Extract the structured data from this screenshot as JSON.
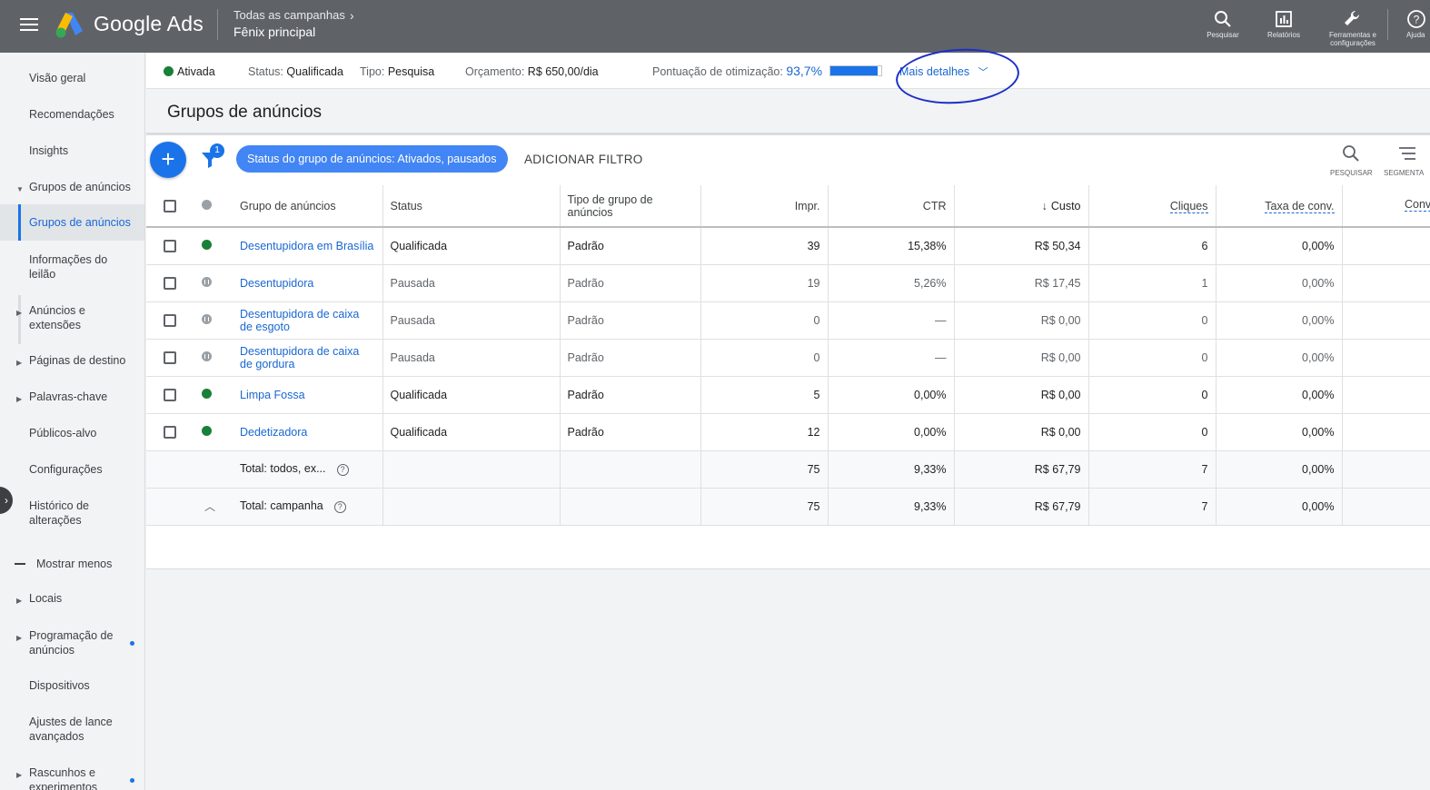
{
  "app": {
    "brand": "Google Ads"
  },
  "breadcrumb": {
    "parent": "Todas as campanhas",
    "current": "Fênix principal"
  },
  "top_tools": [
    {
      "label": "Pesquisar",
      "icon": "search-icon"
    },
    {
      "label": "Relatórios",
      "icon": "reports-icon"
    },
    {
      "label": "Ferramentas e configurações",
      "icon": "wrench-icon"
    },
    {
      "label": "Ajuda",
      "icon": "help-icon"
    }
  ],
  "sidebar": {
    "items": [
      {
        "label": "Visão geral"
      },
      {
        "label": "Recomendações"
      },
      {
        "label": "Insights"
      },
      {
        "label": "Grupos de anúncios",
        "caret": "down"
      },
      {
        "label": "Grupos de anúncios",
        "active": true
      },
      {
        "label": "Informações do leilão"
      },
      {
        "label": "Anúncios e extensões",
        "caret": "right"
      },
      {
        "label": "Páginas de destino",
        "caret": "right"
      },
      {
        "label": "Palavras-chave",
        "caret": "right"
      },
      {
        "label": "Públicos-alvo"
      },
      {
        "label": "Configurações"
      },
      {
        "label": "Histórico de alterações"
      },
      {
        "label": "Mostrar menos"
      },
      {
        "label": "Locais",
        "caret": "right"
      },
      {
        "label": "Programação de anúncios",
        "caret": "right",
        "dot": true
      },
      {
        "label": "Dispositivos"
      },
      {
        "label": "Ajustes de lance avançados"
      },
      {
        "label": "Rascunhos e experimentos",
        "caret": "right",
        "dot": true
      }
    ]
  },
  "campaign_status": {
    "enabled": "Ativada",
    "status_label": "Status:",
    "status_value": "Qualificada",
    "type_label": "Tipo:",
    "type_value": "Pesquisa",
    "budget_label": "Orçamento:",
    "budget_value": "R$ 650,00/dia",
    "opt_label": "Pontuação de otimização:",
    "opt_value": "93,7%",
    "opt_fraction": 0.937,
    "more_details": "Mais detalhes"
  },
  "page": {
    "title": "Grupos de anúncios"
  },
  "toolbar": {
    "filter_count": "1",
    "filter_chip": "Status do grupo de anúncios: Ativados, pausados",
    "add_filter": "ADICIONAR FILTRO",
    "search": "PESQUISAR",
    "segment": "SEGMENTA"
  },
  "table": {
    "headers": {
      "name": "Grupo de anúncios",
      "status": "Status",
      "type": "Tipo de grupo de anúncios",
      "impr": "Impr.",
      "ctr": "CTR",
      "cost": "Custo",
      "clicks": "Cliques",
      "conv_rate": "Taxa de conv.",
      "conv": "Conv"
    },
    "rows": [
      {
        "name": "Desentupidora em Brasília",
        "state": "enabled",
        "status": "Qualificada",
        "type": "Padrão",
        "impr": "39",
        "ctr": "15,38%",
        "cost": "R$ 50,34",
        "clicks": "6",
        "conv_rate": "0,00%"
      },
      {
        "name": "Desentupidora",
        "state": "paused",
        "status": "Pausada",
        "type": "Padrão",
        "impr": "19",
        "ctr": "5,26%",
        "cost": "R$ 17,45",
        "clicks": "1",
        "conv_rate": "0,00%"
      },
      {
        "name": "Desentupidora de caixa de esgoto",
        "state": "paused",
        "status": "Pausada",
        "type": "Padrão",
        "impr": "0",
        "ctr": "—",
        "cost": "R$ 0,00",
        "clicks": "0",
        "conv_rate": "0,00%"
      },
      {
        "name": "Desentupidora de caixa de gordura",
        "state": "paused",
        "status": "Pausada",
        "type": "Padrão",
        "impr": "0",
        "ctr": "—",
        "cost": "R$ 0,00",
        "clicks": "0",
        "conv_rate": "0,00%"
      },
      {
        "name": "Limpa Fossa",
        "state": "enabled",
        "status": "Qualificada",
        "type": "Padrão",
        "impr": "5",
        "ctr": "0,00%",
        "cost": "R$ 0,00",
        "clicks": "0",
        "conv_rate": "0,00%"
      },
      {
        "name": "Dedetizadora",
        "state": "enabled",
        "status": "Qualificada",
        "type": "Padrão",
        "impr": "12",
        "ctr": "0,00%",
        "cost": "R$ 0,00",
        "clicks": "0",
        "conv_rate": "0,00%"
      }
    ],
    "totals": [
      {
        "label": "Total: todos, ex...",
        "impr": "75",
        "ctr": "9,33%",
        "cost": "R$ 67,79",
        "clicks": "7",
        "conv_rate": "0,00%"
      },
      {
        "label": "Total: campanha",
        "impr": "75",
        "ctr": "9,33%",
        "cost": "R$ 67,79",
        "clicks": "7",
        "conv_rate": "0,00%"
      }
    ]
  }
}
